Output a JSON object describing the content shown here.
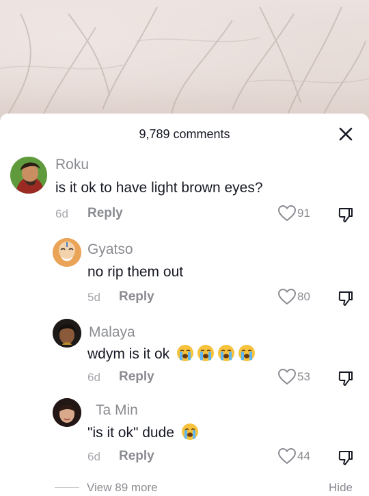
{
  "header": {
    "comment_count": "9,789 comments",
    "close_icon": "close-icon"
  },
  "comments": [
    {
      "username": "Roku",
      "text": "is it ok to have light brown eyes?",
      "time": "6d",
      "reply": "Reply",
      "likes": "91"
    },
    {
      "username": "Gyatso",
      "text": "no rip them out",
      "time": "5d",
      "reply": "Reply",
      "likes": "80"
    },
    {
      "username": "Malaya",
      "text": "wdym is it ok",
      "emoji": "loudly-crying-face",
      "emoji_count": 4,
      "time": "6d",
      "reply": "Reply",
      "likes": "53"
    },
    {
      "username": "Ta Min",
      "text": "\"is it ok\" dude",
      "emoji": "loudly-crying-face",
      "emoji_count": 1,
      "time": "6d",
      "reply": "Reply",
      "likes": "44"
    }
  ],
  "footer": {
    "view_more": "View 89 more",
    "hide": "Hide"
  }
}
